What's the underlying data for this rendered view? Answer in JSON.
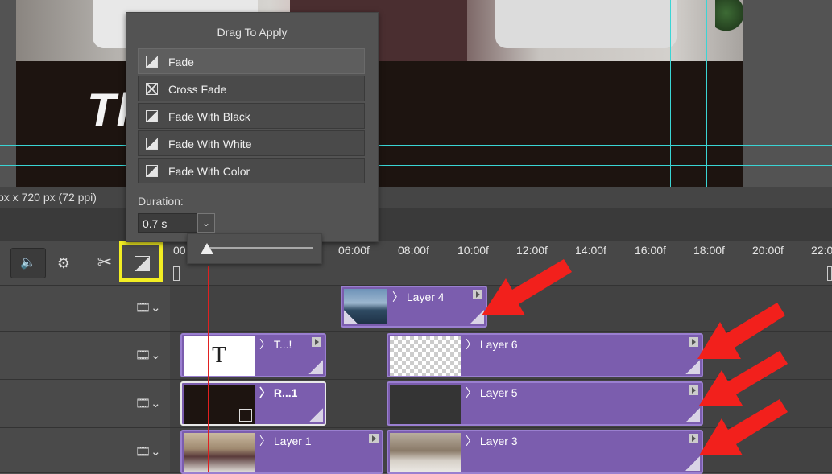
{
  "canvas": {
    "headline": "Th                   o!"
  },
  "doc_info": "px x 720 px (72 ppi)",
  "timeline": {
    "ruler_ticks": [
      "00",
      "06:00f",
      "08:00f",
      "10:00f",
      "12:00f",
      "14:00f",
      "16:00f",
      "18:00f",
      "20:00f",
      "22:0"
    ],
    "controls": {
      "audio_icon": "speaker-icon",
      "settings_icon": "gear-icon",
      "split_icon": "scissors-icon",
      "transition_icon": "transition-icon",
      "transition_highlight_color": "#f3ee23"
    },
    "tracks": [
      {
        "clips": [
          {
            "label": "Layer 4"
          }
        ]
      },
      {
        "clips": [
          {
            "label": "T...!",
            "thumb_text": "T"
          },
          {
            "label": "Layer 6"
          }
        ]
      },
      {
        "clips": [
          {
            "label": "R...1"
          },
          {
            "label": "Layer 5"
          }
        ]
      },
      {
        "clips": [
          {
            "label": "Layer 1"
          },
          {
            "label": "Layer 3"
          }
        ]
      }
    ],
    "clip_color": "#7b5dae",
    "playhead_color": "#e02020"
  },
  "transitions_popup": {
    "title": "Drag To Apply",
    "options": [
      {
        "label": "Fade",
        "icon": "fade-icon",
        "selected": true
      },
      {
        "label": "Cross Fade",
        "icon": "cross-fade-icon",
        "selected": false
      },
      {
        "label": "Fade With Black",
        "icon": "fade-black-icon",
        "selected": false
      },
      {
        "label": "Fade With White",
        "icon": "fade-white-icon",
        "selected": false
      },
      {
        "label": "Fade With Color",
        "icon": "fade-color-icon",
        "selected": false
      }
    ],
    "duration_label": "Duration:",
    "duration_value": "0.7 s"
  },
  "annotations": {
    "arrow_color": "#f2201c",
    "arrow_count": 4
  },
  "guides_color": "#3ad5d5"
}
